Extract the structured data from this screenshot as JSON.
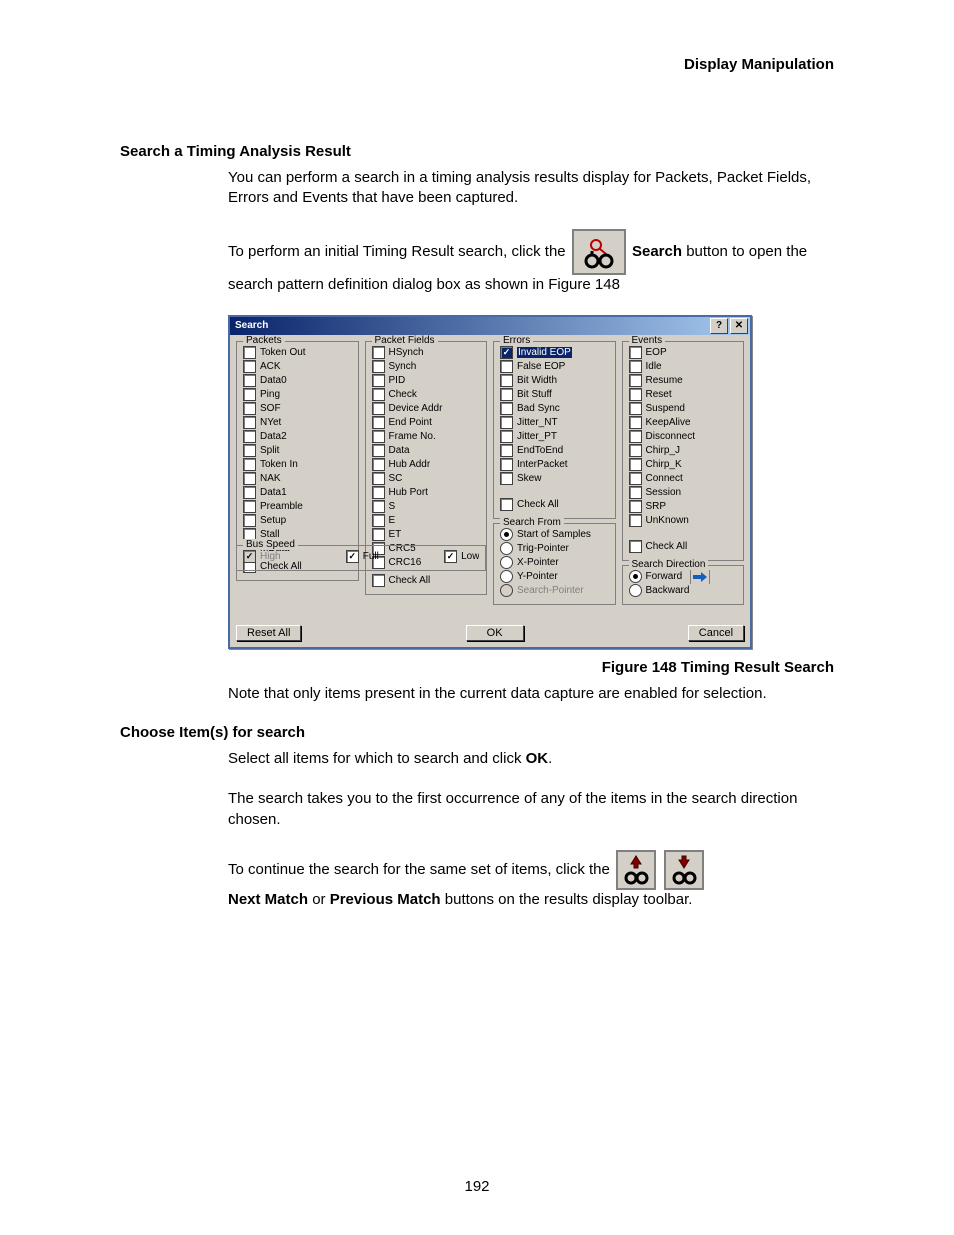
{
  "header": {
    "chapter": "Display Manipulation"
  },
  "section1": {
    "title": "Search a Timing Analysis Result",
    "para1": "You can perform a search in a timing analysis results display for Packets, Packet Fields, Errors and Events that have been captured.",
    "para2_pre": "To perform an initial Timing Result search, click the ",
    "para2_bold": "Search",
    "para2_post": " button to open the search pattern definition dialog box as shown in Figure 148"
  },
  "figure_caption": "Figure  148  Timing Result Search",
  "section2": {
    "note": "Note that only items present in the current data capture are enabled for selection.",
    "title": "Choose Item(s) for search",
    "para1_pre": "Select all items for which to search and click ",
    "para1_bold": "OK",
    "para1_post": ".",
    "para2": "The search takes you to the first occurrence of any of the items in the search direction chosen.",
    "para3_pre": "To continue the search for the same set of items, click the ",
    "para3_bold1": "Next Match",
    "para3_mid": " or ",
    "para3_bold2": "Previous Match",
    "para3_post": " buttons on the results display toolbar."
  },
  "page_number": "192",
  "dialog": {
    "title": "Search",
    "help": "?",
    "close": "✕",
    "groups": {
      "packets": {
        "legend": "Packets",
        "items": [
          "Token Out",
          "ACK",
          "Data0",
          "Ping",
          "SOF",
          "NYet",
          "Data2",
          "Split",
          "Token In",
          "NAK",
          "Data1",
          "Preamble",
          "Setup",
          "Stall",
          "MData"
        ],
        "check_all": "Check All"
      },
      "packet_fields": {
        "legend": "Packet Fields",
        "items": [
          "HSynch",
          "Synch",
          "PID",
          "Check",
          "Device Addr",
          "End Point",
          "Frame No.",
          "Data",
          "Hub Addr",
          "SC",
          "Hub Port",
          "S",
          "E",
          "ET",
          "CRC5",
          "CRC16"
        ],
        "check_all": "Check All"
      },
      "errors": {
        "legend": "Errors",
        "items": [
          {
            "label": "Invalid EOP",
            "checked": true,
            "highlight": true
          },
          {
            "label": "False EOP"
          },
          {
            "label": "Bit Width"
          },
          {
            "label": "Bit Stuff"
          },
          {
            "label": "Bad Sync"
          },
          {
            "label": "Jitter_NT"
          },
          {
            "label": "Jitter_PT"
          },
          {
            "label": "EndToEnd"
          },
          {
            "label": "InterPacket"
          },
          {
            "label": "Skew"
          }
        ],
        "check_all": "Check All"
      },
      "events": {
        "legend": "Events",
        "items": [
          "EOP",
          "Idle",
          "Resume",
          "Reset",
          "Suspend",
          "KeepAlive",
          "Disconnect",
          "Chirp_J",
          "Chirp_K",
          "Connect",
          "Session",
          "SRP",
          "UnKnown"
        ],
        "check_all": "Check All"
      },
      "bus_speed": {
        "legend": "Bus Speed",
        "high": "High",
        "full": "Full",
        "low": "Low"
      },
      "search_from": {
        "legend": "Search From",
        "options": [
          "Start of Samples",
          "Trig-Pointer",
          "X-Pointer",
          "Y-Pointer",
          "Search-Pointer"
        ],
        "selected": 0,
        "disabled": [
          4
        ]
      },
      "search_direction": {
        "legend": "Search Direction",
        "options": [
          "Forward",
          "Backward"
        ],
        "selected": 0
      }
    },
    "buttons": {
      "reset": "Reset All",
      "ok": "OK",
      "cancel": "Cancel"
    }
  }
}
